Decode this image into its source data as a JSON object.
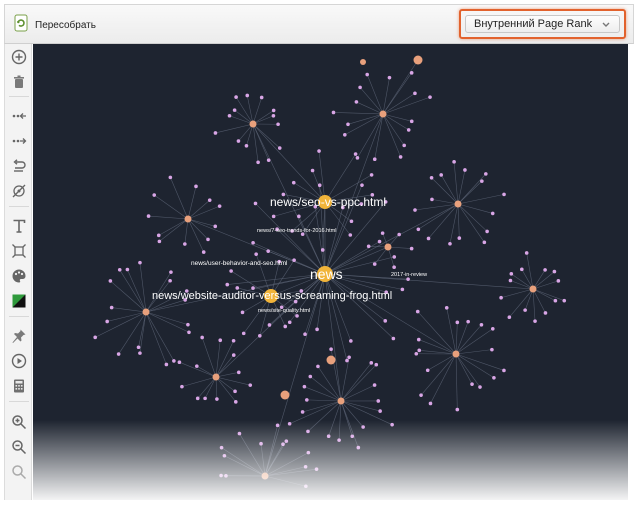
{
  "toolbar": {
    "rebuild_label": "Пересобрать",
    "metric_selected": "Внутренний Page Rank"
  },
  "sidebar": {
    "tools": [
      "add-icon",
      "trash-icon",
      "collapse-links-icon",
      "expand-links-icon",
      "undo-icon",
      "hide-links-icon",
      "text-icon",
      "fit-icon",
      "palette-icon",
      "color-scheme-icon",
      "pin-icon",
      "play-icon",
      "calculator-icon",
      "zoom-in-icon",
      "zoom-out-icon",
      "zoom-reset-icon"
    ]
  },
  "graph": {
    "labels": {
      "news": "news",
      "seo_vs_ppc": "news/seo-vs-ppc.html",
      "auditor_vs_frog": "news/website-auditor-versus-screaming-frog.html",
      "seo_trends": "news/7-seo-trends-for-2016.html",
      "user_behavior": "news/user-behavior-and-seo.html",
      "site_quality": "news/site-quality.html",
      "review_2017": "2017-in-review"
    },
    "colors": {
      "background": "#1e2430",
      "edge": "#5c6476",
      "leaf": "#d9a6e6",
      "hub": "#e8a07c",
      "hub_large": "#f1b43a"
    }
  }
}
